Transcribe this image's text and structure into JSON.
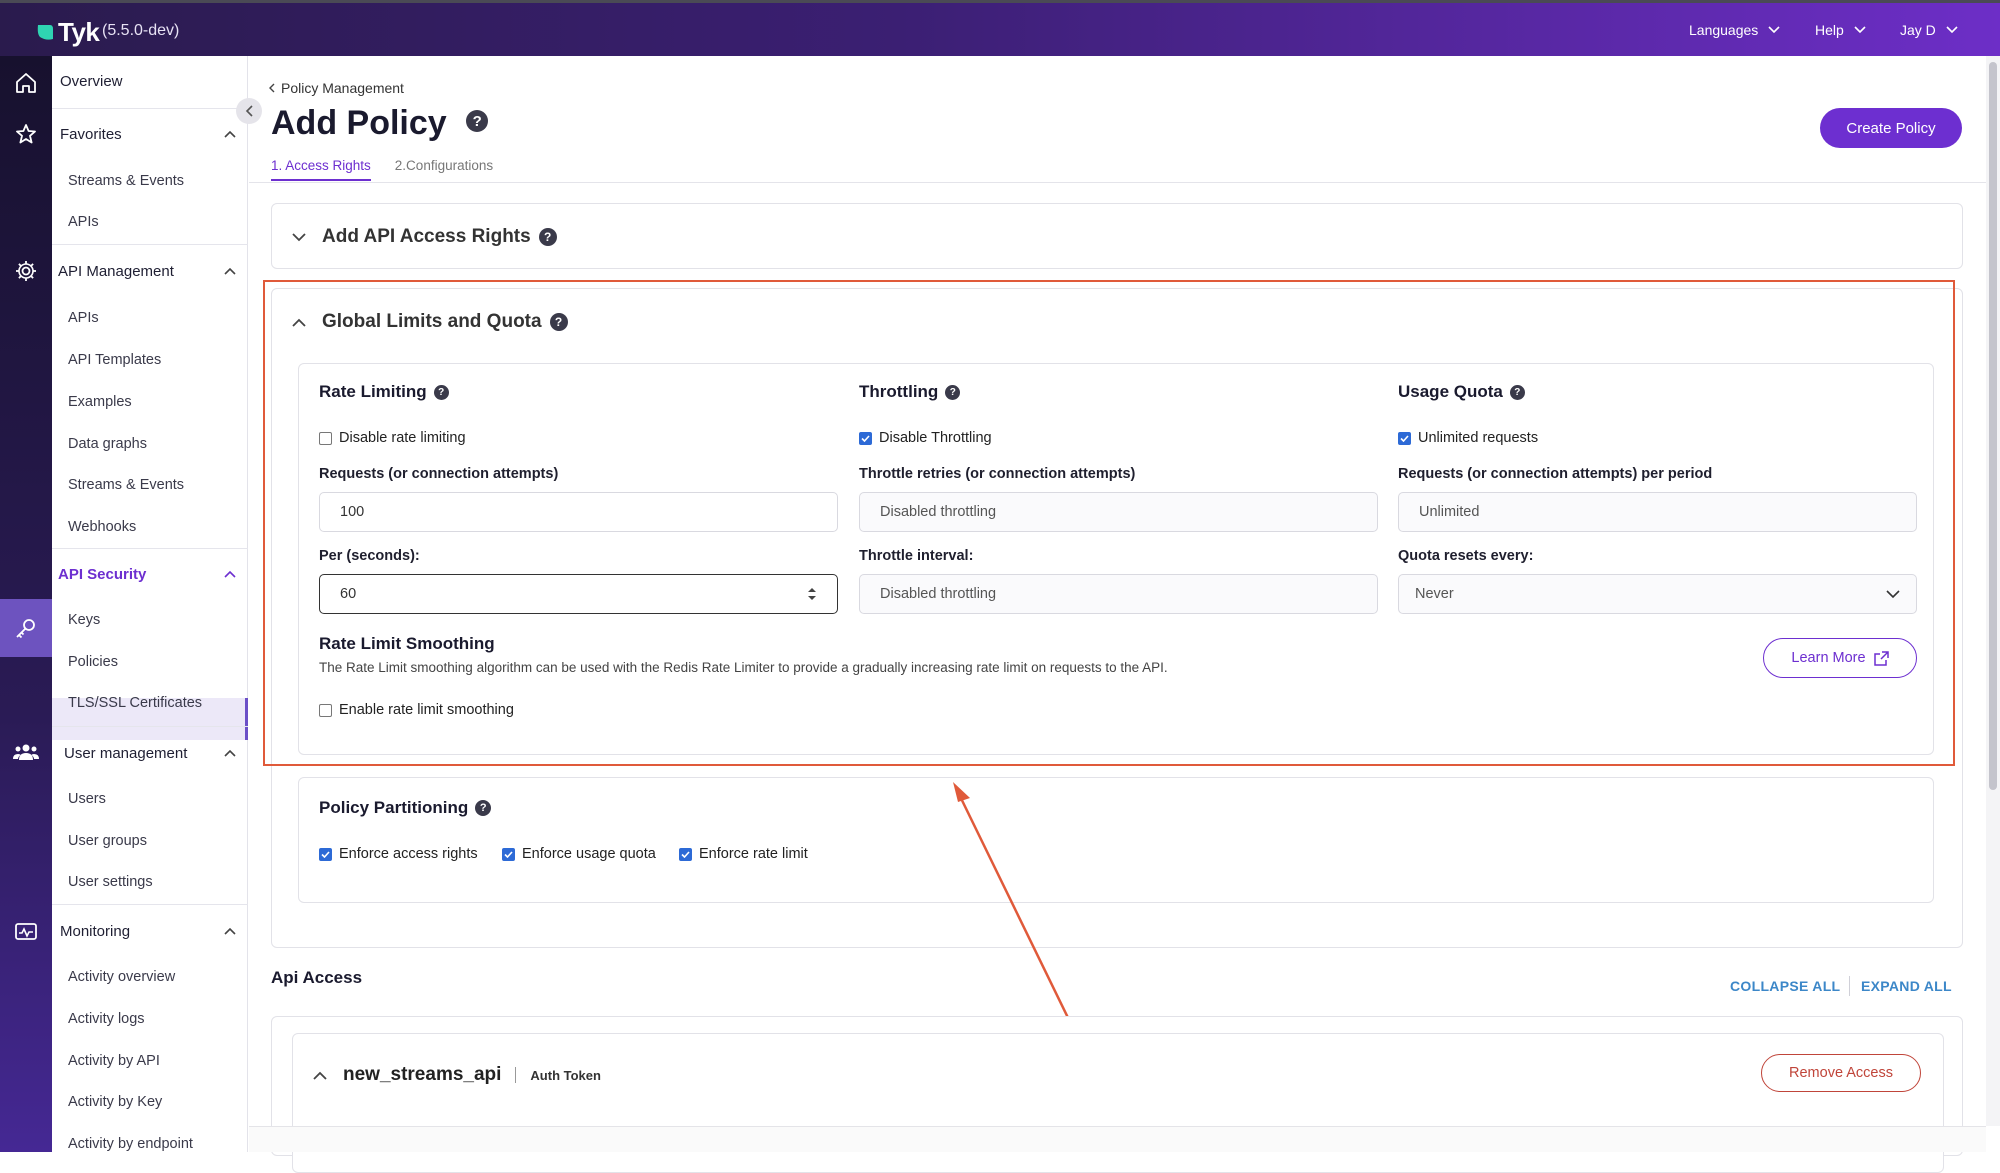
{
  "topbar": {
    "brand": "Tyk",
    "version": "(5.5.0-dev)",
    "nav": [
      {
        "label": "Languages"
      },
      {
        "label": "Help"
      },
      {
        "label": "Jay D"
      }
    ]
  },
  "sidebar": {
    "overview": "Overview",
    "favorites": {
      "label": "Favorites",
      "items": [
        "Streams & Events",
        "APIs"
      ]
    },
    "api_management": {
      "label": "API Management",
      "items": [
        "APIs",
        "API Templates",
        "Examples",
        "Data graphs",
        "Streams & Events",
        "Webhooks"
      ]
    },
    "api_security": {
      "label": "API Security",
      "items": [
        "Keys",
        "Policies",
        "TLS/SSL Certificates"
      ]
    },
    "user_management": {
      "label": "User management",
      "items": [
        "Users",
        "User groups",
        "User settings"
      ]
    },
    "monitoring": {
      "label": "Monitoring",
      "items": [
        "Activity overview",
        "Activity logs",
        "Activity by API",
        "Activity by Key",
        "Activity by endpoint"
      ]
    }
  },
  "header": {
    "breadcrumb": "Policy Management",
    "title": "Add Policy",
    "help": "?",
    "create_button": "Create Policy",
    "tabs": [
      {
        "label": "1. Access Rights"
      },
      {
        "label": "2.Configurations"
      }
    ]
  },
  "access_rights": {
    "title": "Add API Access Rights"
  },
  "global_limits": {
    "title": "Global Limits and Quota",
    "rate_limiting": {
      "title": "Rate Limiting",
      "disable_label": "Disable rate limiting",
      "disable_checked": false,
      "requests_label": "Requests (or connection attempts)",
      "requests_value": "100",
      "per_label": "Per (seconds):",
      "per_value": "60"
    },
    "throttling": {
      "title": "Throttling",
      "disable_label": "Disable Throttling",
      "disable_checked": true,
      "retries_label": "Throttle retries (or connection attempts)",
      "retries_value": "Disabled throttling",
      "interval_label": "Throttle interval:",
      "interval_value": "Disabled throttling"
    },
    "usage_quota": {
      "title": "Usage Quota",
      "unlimited_label": "Unlimited requests",
      "unlimited_checked": true,
      "requests_label": "Requests (or connection attempts) per period",
      "requests_value": "Unlimited",
      "resets_label": "Quota resets every:",
      "resets_value": "Never"
    },
    "smoothing": {
      "title": "Rate Limit Smoothing",
      "description": "The Rate Limit smoothing algorithm can be used with the Redis Rate Limiter to provide a gradually increasing rate limit on requests to the API.",
      "enable_label": "Enable rate limit smoothing",
      "enable_checked": false,
      "learn_more": "Learn More"
    }
  },
  "partitioning": {
    "title": "Policy Partitioning",
    "options": [
      {
        "label": "Enforce access rights",
        "checked": true
      },
      {
        "label": "Enforce usage quota",
        "checked": true
      },
      {
        "label": "Enforce rate limit",
        "checked": true
      }
    ]
  },
  "api_access": {
    "title": "Api Access",
    "collapse_all": "COLLAPSE ALL",
    "expand_all": "EXPAND ALL",
    "api_name": "new_streams_api",
    "auth_type": "Auth Token",
    "remove_button": "Remove Access"
  },
  "colors": {
    "brand_purple": "#6d2fd0",
    "annotation_red": "#e05a3a",
    "checkbox_blue": "#2d6ad6",
    "remove_red": "#c0453a",
    "link_blue": "#3c87c8"
  }
}
